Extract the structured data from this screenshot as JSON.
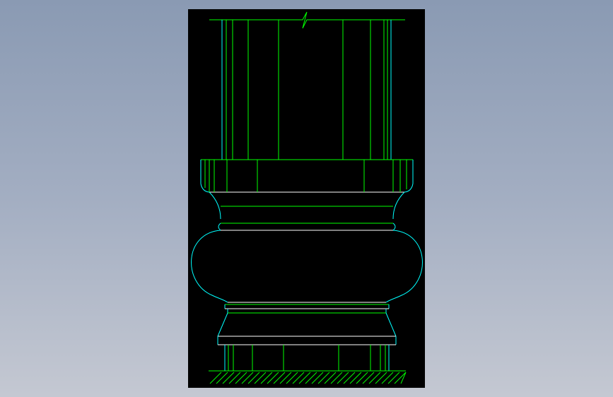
{
  "drawing": {
    "subject": "column-base-elevation",
    "background_color": "#000000",
    "colors": {
      "green_lines": "#00ff00",
      "cyan_lines": "#00ffff",
      "white_lines": "#ffffff"
    },
    "elements": [
      "break-line",
      "column-shaft",
      "plinth-block",
      "upper-neck-fillet",
      "bulbous-drum",
      "lower-fillet",
      "tapered-collar",
      "base-block",
      "ground-hatch"
    ]
  }
}
